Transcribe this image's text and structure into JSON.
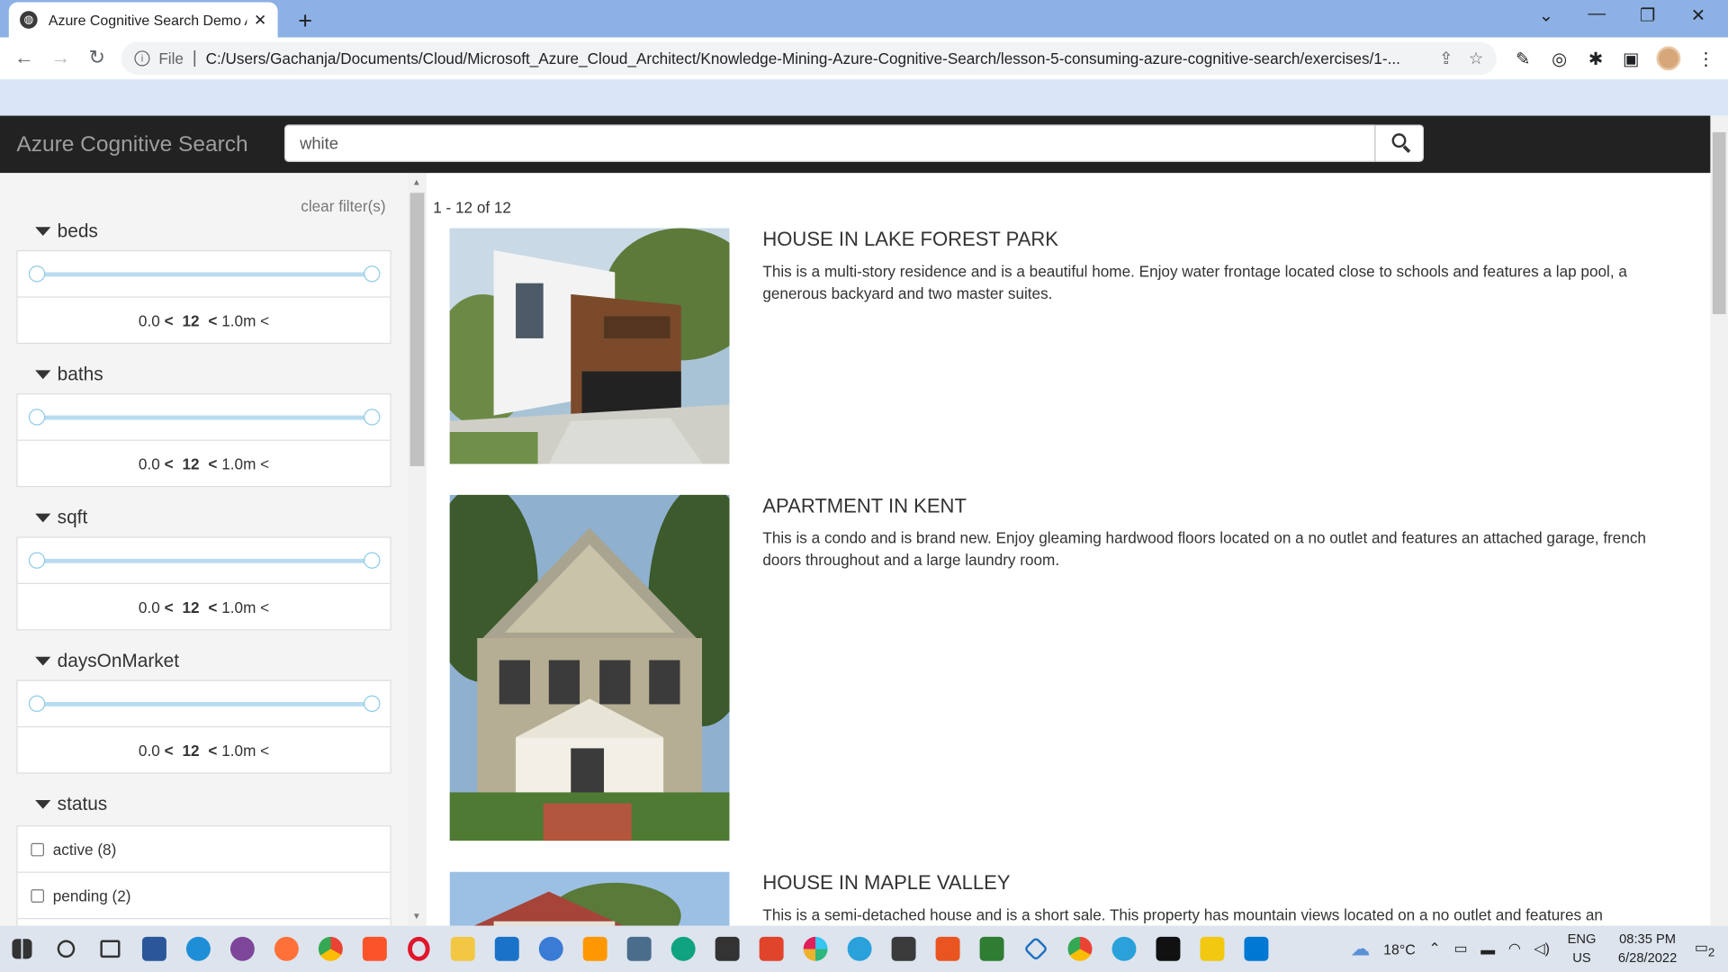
{
  "browser": {
    "tab_title": "Azure Cognitive Search Demo Ap",
    "new_tab": "+",
    "url_scheme_label": "File",
    "url": "C:/Users/Gachanja/Documents/Cloud/Microsoft_Azure_Cloud_Architect/Knowledge-Mining-Azure-Cognitive-Search/lesson-5-consuming-azure-cognitive-search/exercises/1-..."
  },
  "app": {
    "brand": "Azure Cognitive Search",
    "search_value": "white"
  },
  "sidebar": {
    "clear_filters": "clear filter(s)",
    "facets": [
      {
        "name": "beds",
        "min": "0.0",
        "mid": "12",
        "max": "1.0m"
      },
      {
        "name": "baths",
        "min": "0.0",
        "mid": "12",
        "max": "1.0m"
      },
      {
        "name": "sqft",
        "min": "0.0",
        "mid": "12",
        "max": "1.0m"
      },
      {
        "name": "daysOnMarket",
        "min": "0.0",
        "mid": "12",
        "max": "1.0m"
      }
    ],
    "lt": "<",
    "status": {
      "title": "status",
      "options": [
        "active (8)",
        "pending (2)"
      ]
    }
  },
  "results": {
    "count": "1 - 12 of 12",
    "items": [
      {
        "title": "HOUSE IN LAKE FOREST PARK",
        "description": "This is a multi-story residence and is a beautiful home. Enjoy water frontage located close to schools and features a lap pool, a generous backyard and two master suites."
      },
      {
        "title": "APARTMENT IN KENT",
        "description": "This is a condo and is brand new. Enjoy gleaming hardwood floors located on a no outlet and features an attached garage, french doors throughout and a large laundry room."
      },
      {
        "title": "HOUSE IN MAPLE VALLEY",
        "description": "This is a semi-detached house and is a short sale. This property has mountain views located on a no outlet and features an"
      }
    ]
  },
  "taskbar": {
    "weather": "18°C",
    "lang1": "ENG",
    "lang2": "US",
    "time": "08:35 PM",
    "date": "6/28/2022",
    "notif_count": "2"
  }
}
